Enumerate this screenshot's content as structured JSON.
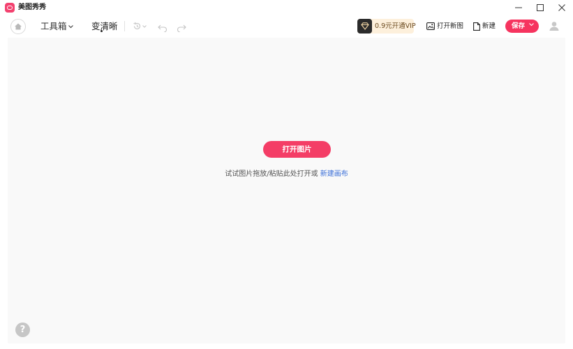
{
  "app": {
    "title": "美图秀秀"
  },
  "toolbar": {
    "toolbox_label": "工具箱",
    "clarity_label": "变清晰",
    "vip_label": "0.9元开通VIP",
    "open_new_label": "打开新图",
    "new_label": "新建",
    "save_label": "保存"
  },
  "canvas": {
    "open_image_label": "打开图片",
    "hint_text": "试试图片拖放/粘贴此处打开或",
    "hint_link": "新建画布",
    "help_label": "?"
  },
  "colors": {
    "accent": "#f6345f",
    "link": "#3b6fd8",
    "canvas_bg": "#f9f9f9",
    "vip_bg": "#fdf0dc"
  },
  "icons": {
    "app": "meitu-logo-icon",
    "home": "home-icon",
    "history": "history-icon",
    "undo": "undo-icon",
    "redo": "redo-icon",
    "vip": "diamond-icon",
    "open_new": "open-image-icon",
    "new": "new-file-icon",
    "avatar": "user-icon"
  }
}
